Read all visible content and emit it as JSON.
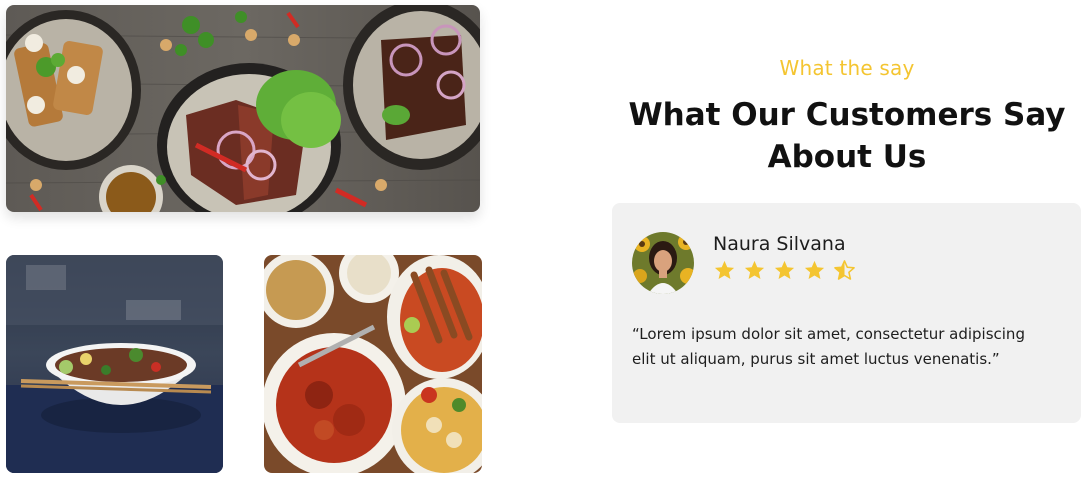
{
  "section": {
    "eyebrow": "What the say",
    "title": "What Our Customers Say About Us"
  },
  "gallery": {
    "images": [
      "grilled-steak-dishes-photo",
      "noodle-bowl-photo",
      "indonesian-dishes-spread-photo"
    ]
  },
  "testimonial": {
    "name": "Naura Silvana",
    "rating": 4.5,
    "rating_max": 5,
    "quote": "“Lorem ipsum dolor sit amet, consectetur adipiscing elit ut aliquam, purus sit amet luctus venenatis.”"
  },
  "colors": {
    "accent": "#f4c531",
    "heading": "#111111",
    "card_bg": "#f1f1f1",
    "star": "#f4c531"
  }
}
